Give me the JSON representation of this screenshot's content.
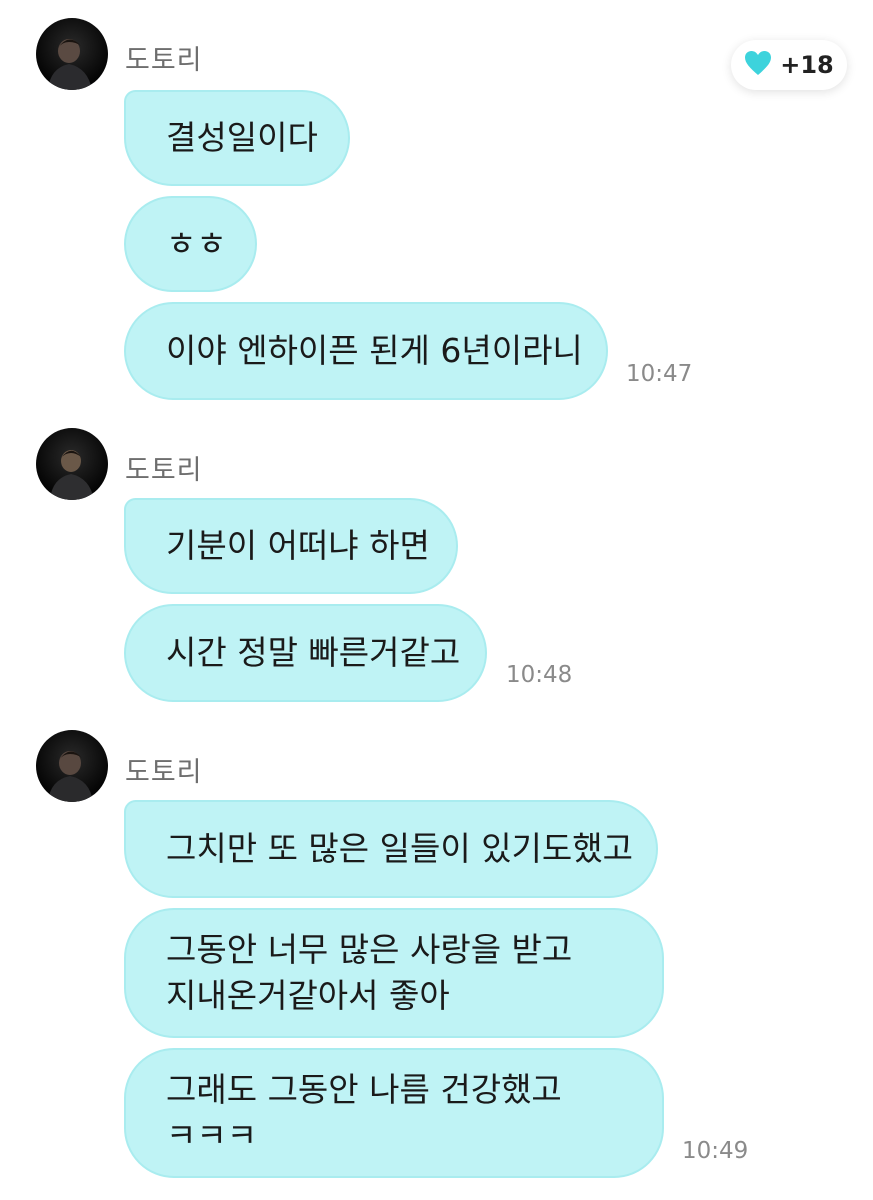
{
  "reaction": {
    "icon": "heart-icon",
    "count": "+18",
    "color": "#3dd3dc"
  },
  "bubble_color": "#bff3f5",
  "groups": [
    {
      "sender": "도토리",
      "messages": [
        "결성일이다",
        "ㅎㅎ",
        "이야 엔하이픈 된게 6년이라니"
      ],
      "time": "10:47"
    },
    {
      "sender": "도토리",
      "messages": [
        "기분이 어떠냐 하면",
        "시간 정말 빠른거같고"
      ],
      "time": "10:48"
    },
    {
      "sender": "도토리",
      "messages": [
        "그치만 또 많은 일들이 있기도했고",
        "그동안 너무 많은 사랑을 받고 지내온거같아서 좋아",
        "그래도 그동안 나름 건강했고 ㅋㅋㅋ"
      ],
      "time": "10:49"
    }
  ]
}
